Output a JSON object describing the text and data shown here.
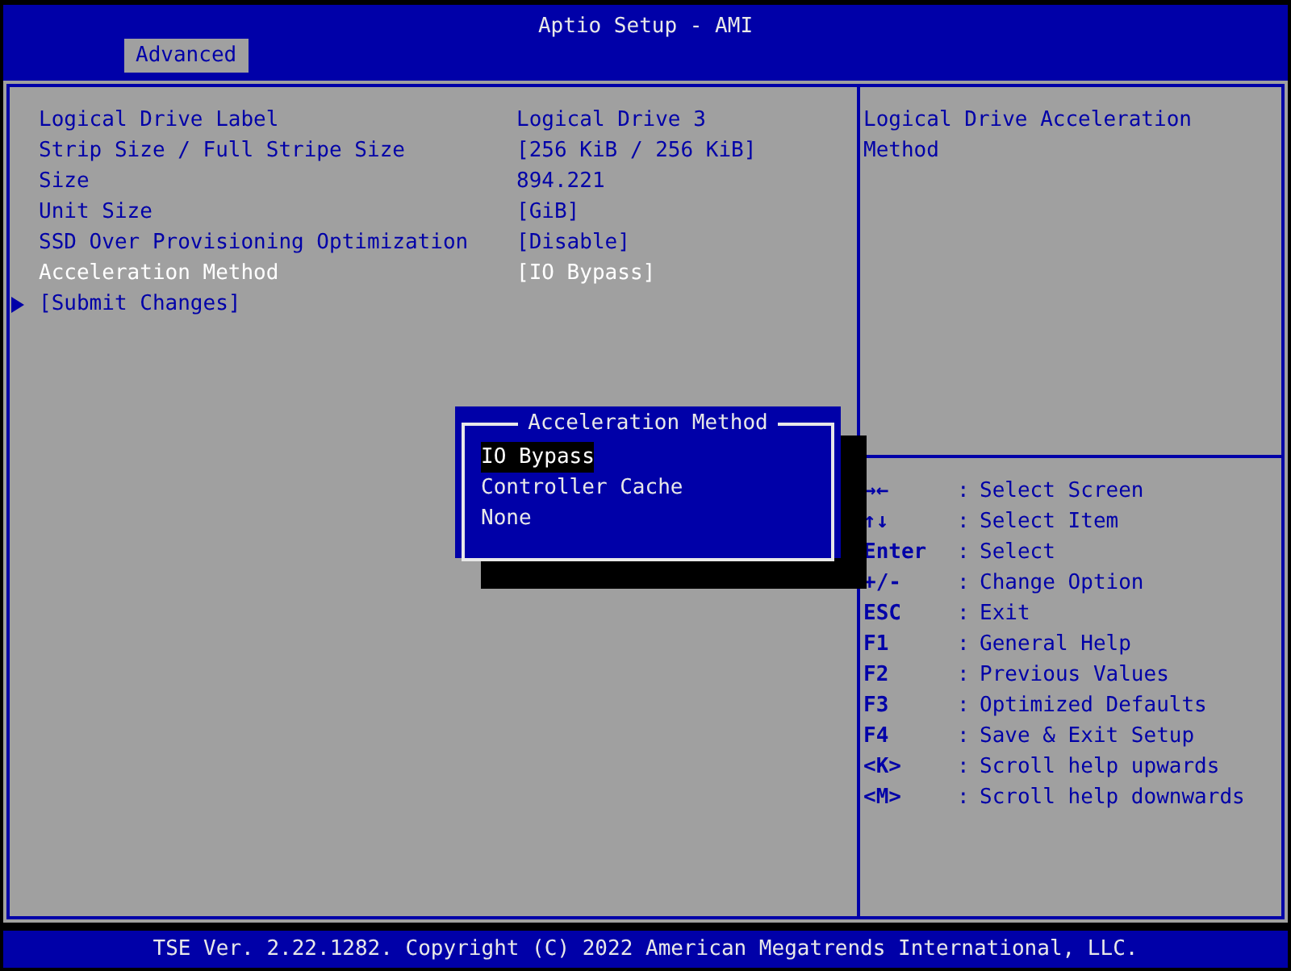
{
  "window": {
    "title": "Aptio Setup - AMI"
  },
  "tabs": [
    {
      "label": "Advanced",
      "selected": true
    }
  ],
  "settings": [
    {
      "kind": "field",
      "label": "Logical Drive Label",
      "value": "Logical Drive 3",
      "selected": false
    },
    {
      "kind": "field",
      "label": "Strip Size / Full Stripe Size",
      "value": "[256 KiB / 256 KiB]",
      "selected": false
    },
    {
      "kind": "field",
      "label": "Size",
      "value": "894.221",
      "selected": false
    },
    {
      "kind": "field",
      "label": "Unit Size",
      "value": "[GiB]",
      "selected": false
    },
    {
      "kind": "field",
      "label": "SSD Over Provisioning Optimization",
      "value": "[Disable]",
      "selected": false
    },
    {
      "kind": "field",
      "label": "Acceleration Method",
      "value": "[IO Bypass]",
      "selected": true
    },
    {
      "kind": "submenu",
      "label": "[Submit Changes]",
      "selected": false
    }
  ],
  "help": {
    "text": "Logical Drive Acceleration Method"
  },
  "keys": [
    {
      "key": "→←",
      "separator": ":",
      "action": "Select Screen"
    },
    {
      "key": "↑↓",
      "separator": ":",
      "action": "Select Item"
    },
    {
      "key": "Enter",
      "separator": ":",
      "action": "Select"
    },
    {
      "key": "+/-",
      "separator": ":",
      "action": "Change Option"
    },
    {
      "key": "ESC",
      "separator": ":",
      "action": "Exit"
    },
    {
      "key": "F1",
      "separator": ":",
      "action": "General Help"
    },
    {
      "key": "F2",
      "separator": ":",
      "action": "Previous Values"
    },
    {
      "key": "F3",
      "separator": ":",
      "action": "Optimized Defaults"
    },
    {
      "key": "F4",
      "separator": ":",
      "action": "Save & Exit Setup"
    },
    {
      "key": "<K>",
      "separator": ":",
      "action": "Scroll help upwards"
    },
    {
      "key": "<M>",
      "separator": ":",
      "action": "Scroll help downwards"
    }
  ],
  "popup": {
    "title": "Acceleration Method",
    "options": [
      {
        "label": "IO Bypass",
        "selected": true
      },
      {
        "label": "Controller Cache",
        "selected": false
      },
      {
        "label": "None",
        "selected": false
      }
    ]
  },
  "status_bar": "TSE Ver. 2.22.1282. Copyright (C) 2022 American Megatrends International, LLC."
}
